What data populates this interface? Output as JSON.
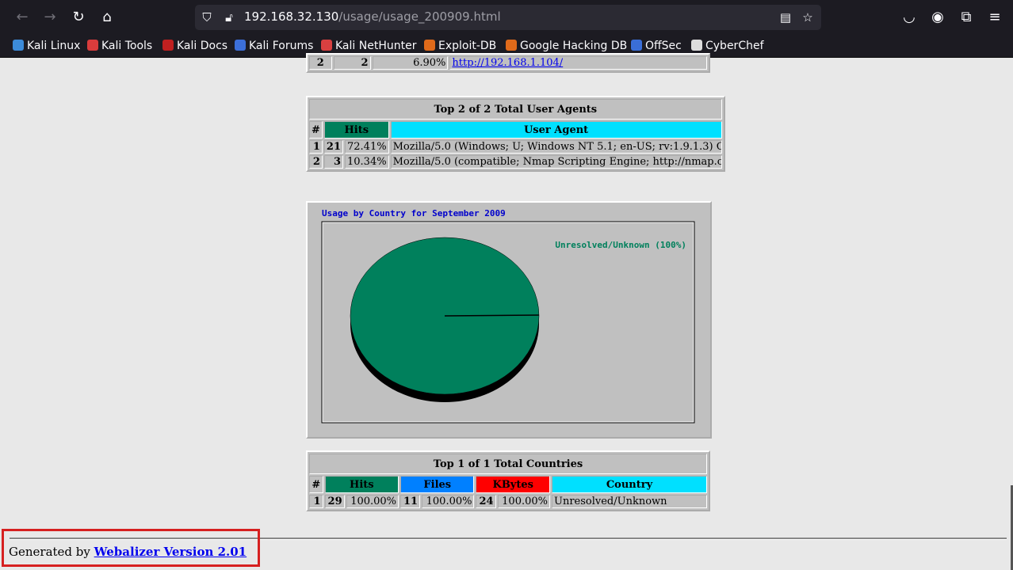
{
  "browser": {
    "url_host": "192.168.32.130",
    "url_path": "/usage/usage_200909.html",
    "bookmarks": [
      "Kali Linux",
      "Kali Tools",
      "Kali Docs",
      "Kali Forums",
      "Kali NetHunter",
      "Exploit-DB",
      "Google Hacking DB",
      "OffSec",
      "CyberChef"
    ]
  },
  "referrer_partial_row": {
    "rank": "2",
    "hits": "2",
    "pct": "6.90%",
    "url": "http://192.168.1.104/"
  },
  "user_agents": {
    "title": "Top 2 of 2 Total User Agents",
    "headers": {
      "rank": "#",
      "hits": "Hits",
      "agent": "User Agent"
    },
    "rows": [
      {
        "rank": "1",
        "hits": "21",
        "pct": "72.41%",
        "agent": "Mozilla/5.0 (Windows; U; Windows NT 5.1; en-US; rv:1.9.1.3) G"
      },
      {
        "rank": "2",
        "hits": "3",
        "pct": "10.34%",
        "agent": "Mozilla/5.0 (compatible; Nmap Scripting Engine; http://nmap.o"
      }
    ]
  },
  "chart_data": {
    "type": "pie",
    "title": "Usage by Country for September 2009",
    "slices": [
      {
        "label": "Unresolved/Unknown (100%)",
        "value": 100,
        "color": "#00805c"
      }
    ]
  },
  "countries": {
    "title": "Top 1 of 1 Total Countries",
    "headers": {
      "rank": "#",
      "hits": "Hits",
      "files": "Files",
      "kbytes": "KBytes",
      "country": "Country"
    },
    "rows": [
      {
        "rank": "1",
        "hits": "29",
        "hits_pct": "100.00%",
        "files": "11",
        "files_pct": "100.00%",
        "kbytes": "24",
        "kbytes_pct": "100.00%",
        "country": "Unresolved/Unknown"
      }
    ]
  },
  "footer": {
    "prefix": "Generated by ",
    "link": "Webalizer Version 2.01"
  }
}
